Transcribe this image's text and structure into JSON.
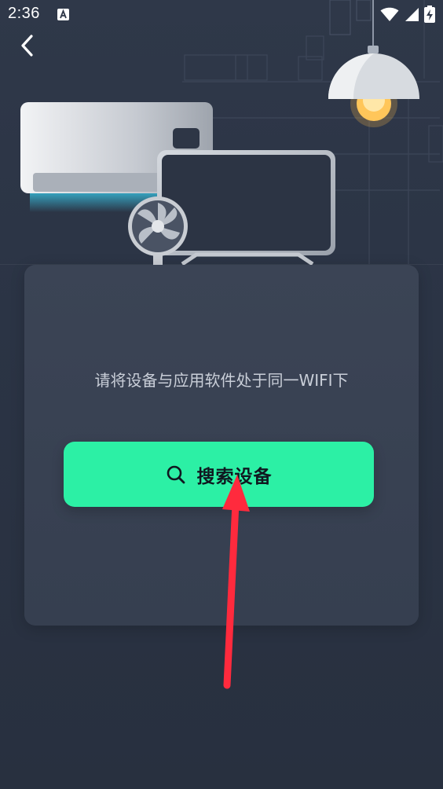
{
  "status_bar": {
    "time": "2:36",
    "icons": [
      "a-notification-icon",
      "wifi-icon",
      "signal-icon",
      "battery-charging-icon"
    ]
  },
  "nav": {
    "back_icon": "chevron-left-icon"
  },
  "card": {
    "hint": "请将设备与应用软件处于同一WIFI下",
    "search_button_label": "搜索设备",
    "search_icon": "search-icon"
  },
  "colors": {
    "background": "#2b3445",
    "card": "#394253",
    "accent": "#2cf0a5",
    "annotation_arrow": "#ff2a3d"
  }
}
